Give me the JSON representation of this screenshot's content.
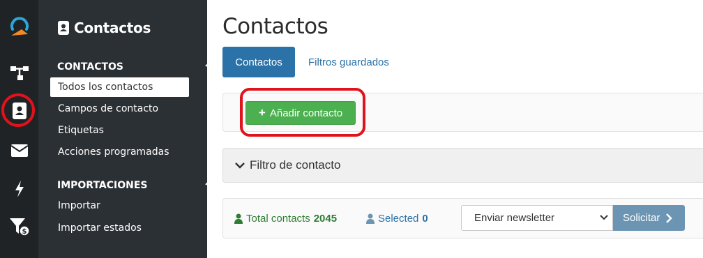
{
  "sidebar": {
    "title": "Contactos",
    "sections": [
      {
        "label": "CONTACTOS",
        "items": [
          "Todos los contactos",
          "Campos de contacto",
          "Etiquetas",
          "Acciones programadas"
        ]
      },
      {
        "label": "IMPORTACIONES",
        "items": [
          "Importar",
          "Importar estados"
        ]
      }
    ],
    "active_item": "Todos los contactos"
  },
  "rail": {
    "icons": [
      "logo-icon",
      "flow-icon",
      "contacts-icon",
      "envelope-icon",
      "bolt-icon",
      "funnel-money-icon"
    ],
    "highlighted": "contacts-icon"
  },
  "main": {
    "title": "Contactos",
    "tabs": [
      {
        "label": "Contactos",
        "active": true
      },
      {
        "label": "Filtros guardados",
        "active": false
      }
    ],
    "add_button": "Añadir contacto",
    "filter_label": "Filtro de contacto",
    "stats": {
      "total_label": "Total contacts",
      "total_value": "2045",
      "selected_label": "Selected",
      "selected_value": "0"
    },
    "action_select": "Enviar newsletter",
    "submit_label": "Solicitar"
  },
  "colors": {
    "rail_bg": "#1f2326",
    "sidebar_bg": "#2b3034",
    "primary": "#2a72a8",
    "success": "#4caf50",
    "highlight": "#e0121b"
  }
}
